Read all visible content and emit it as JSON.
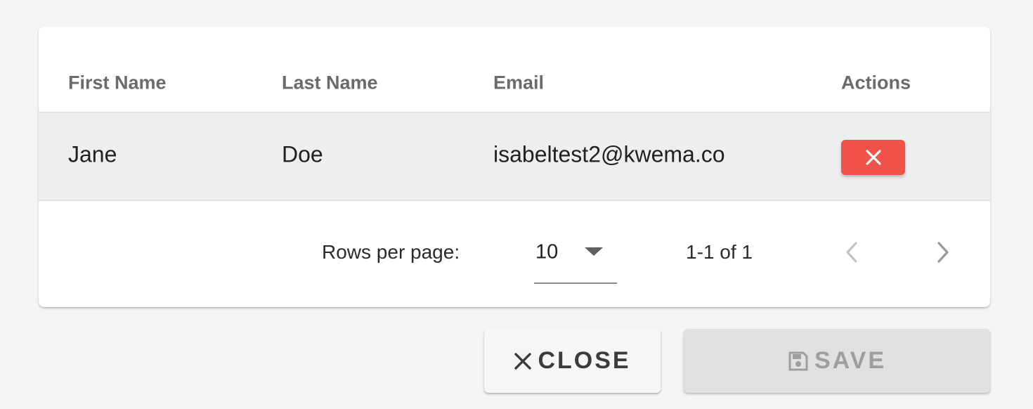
{
  "table": {
    "columns": [
      "First Name",
      "Last Name",
      "Email",
      "Actions"
    ],
    "rows": [
      {
        "first_name": "Jane",
        "last_name": "Doe",
        "email": "isabeltest2@kwema.co",
        "action_icon": "close-icon"
      }
    ]
  },
  "pagination": {
    "rows_per_page_label": "Rows per page:",
    "rows_per_page_value": "10",
    "range_text": "1-1 of 1",
    "prev_icon": "chevron-left-icon",
    "next_icon": "chevron-right-icon"
  },
  "actions": {
    "close_label": "CLOSE",
    "close_icon": "close-icon",
    "save_label": "SAVE",
    "save_icon": "floppy-disk-icon"
  },
  "colors": {
    "delete_button": "#f0524a",
    "row_background": "#eeeeee",
    "page_background": "#f4f4f4",
    "save_disabled_background": "#e0e0e0"
  }
}
